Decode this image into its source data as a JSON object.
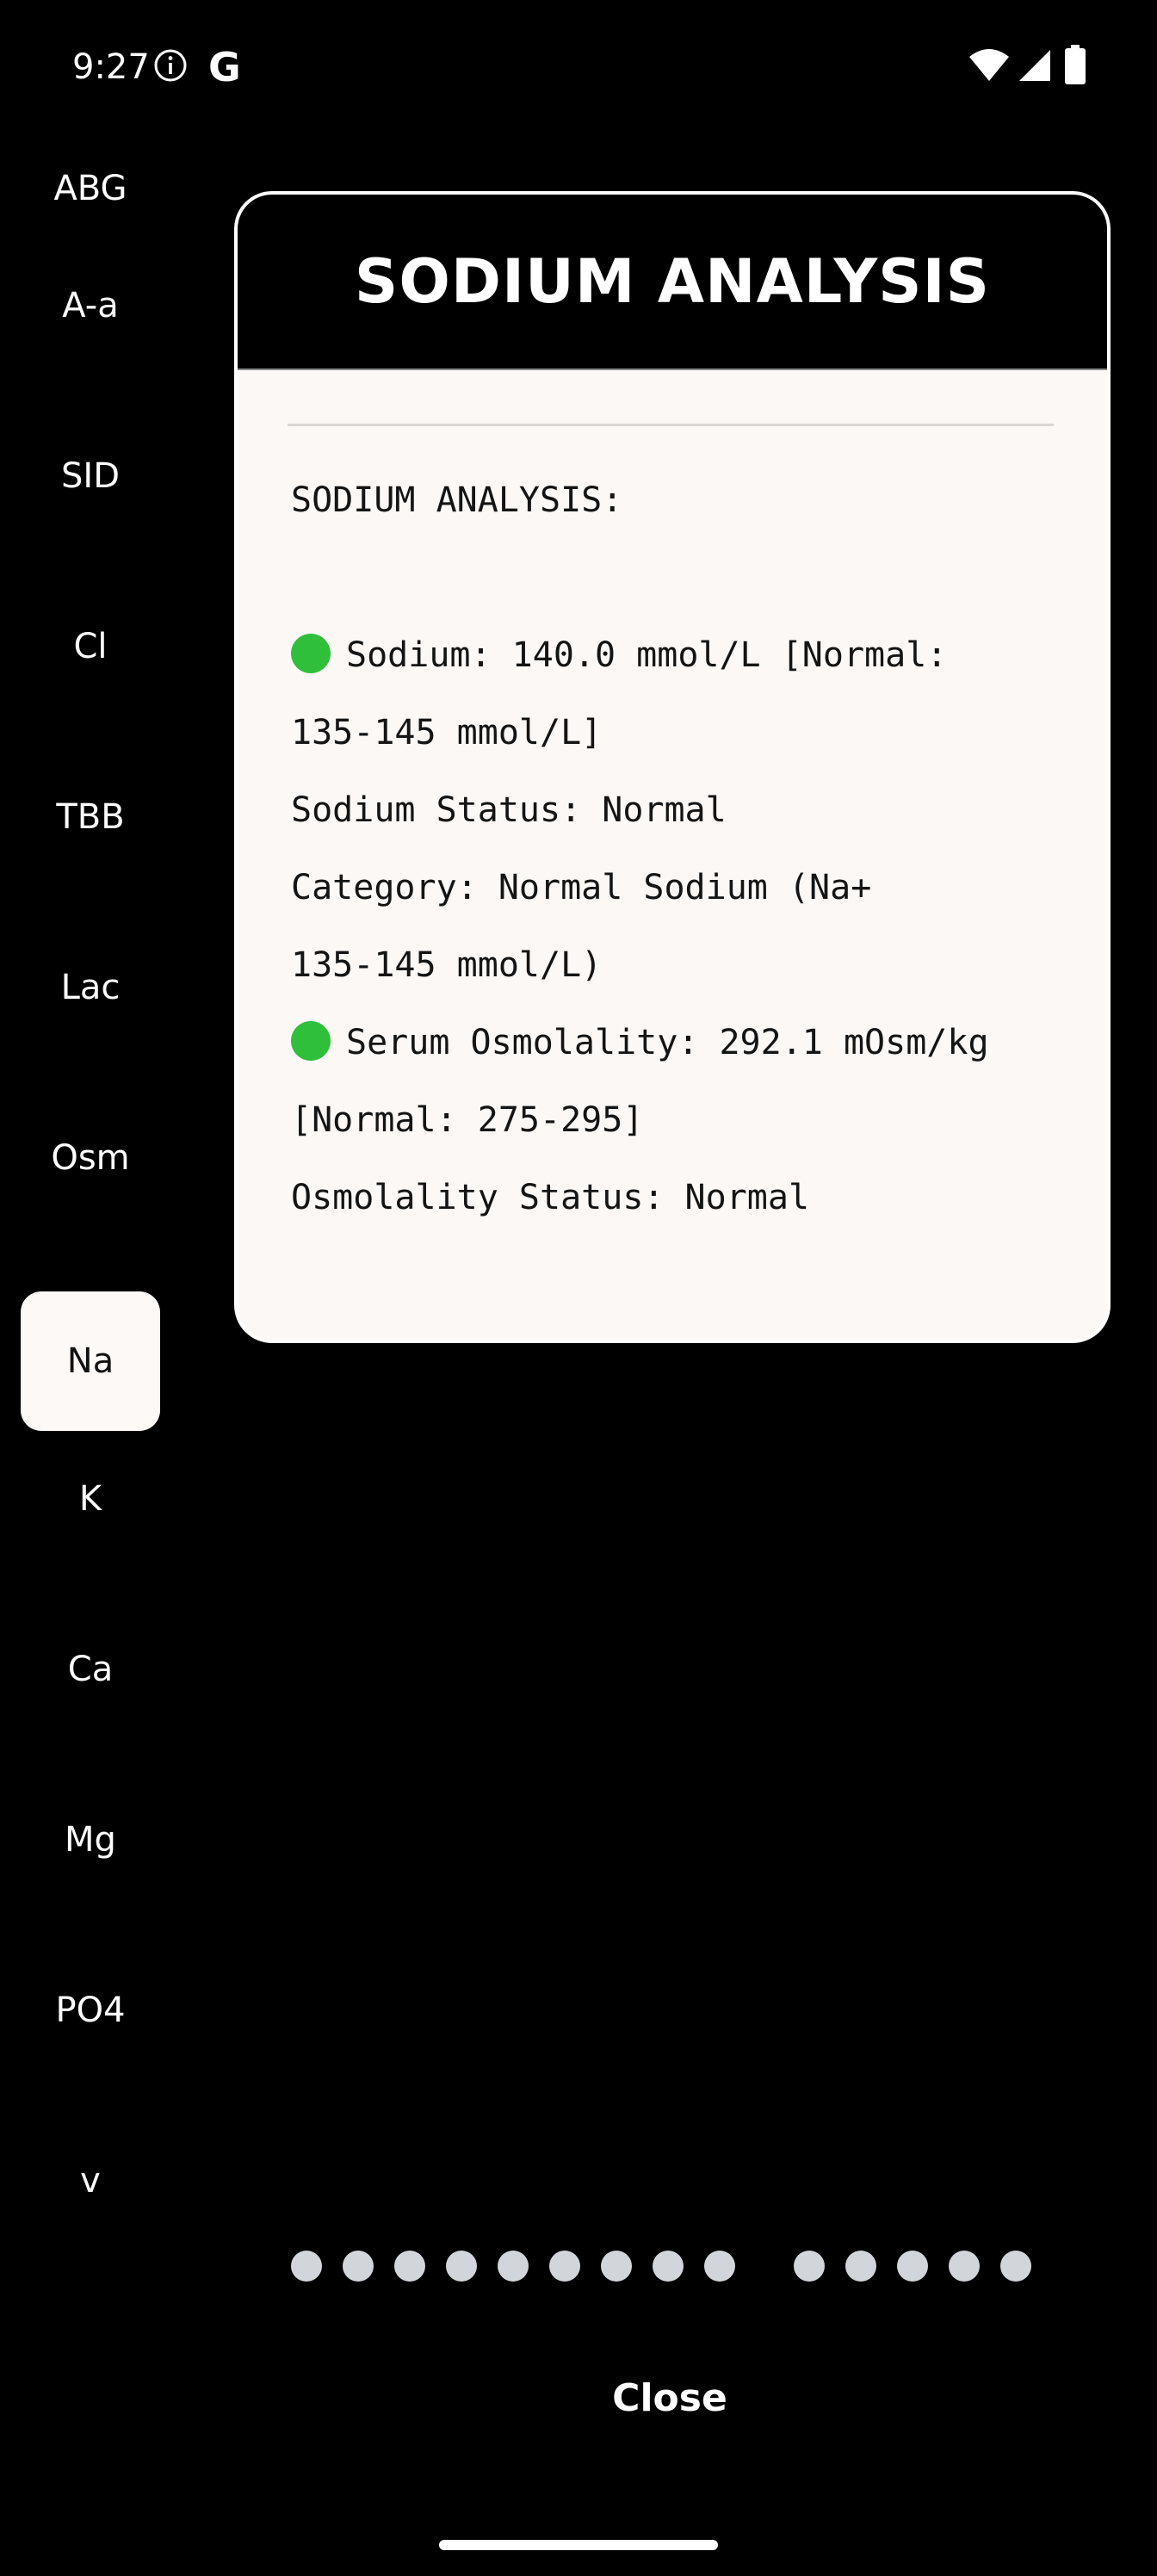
{
  "status_bar": {
    "time": "9:27",
    "icons": [
      "info-icon",
      "google-icon",
      "wifi-icon",
      "signal-icon",
      "battery-icon"
    ],
    "google_letter": "G"
  },
  "rail": {
    "items": [
      {
        "label": "ABG",
        "active": false
      },
      {
        "label": "A-a",
        "active": false
      },
      {
        "label": "SID",
        "active": false
      },
      {
        "label": "Cl",
        "active": false
      },
      {
        "label": "TBB",
        "active": false
      },
      {
        "label": "Lac",
        "active": false
      },
      {
        "label": "Osm",
        "active": false
      },
      {
        "label": "Na",
        "active": true
      },
      {
        "label": "K",
        "active": false
      },
      {
        "label": "Ca",
        "active": false
      },
      {
        "label": "Mg",
        "active": false
      },
      {
        "label": "PO4",
        "active": false
      },
      {
        "label": "v",
        "active": false
      }
    ]
  },
  "dialog": {
    "title": "SODIUM ANALYSIS",
    "heading": "SODIUM ANALYSIS:",
    "lines": {
      "sodium_a": "Sodium: 140.0 mmol/L [Normal:",
      "sodium_b": "135-145 mmol/L]",
      "sodium_status": "Sodium Status: Normal",
      "category_a": "Category: Normal Sodium (Na+",
      "category_b": "135-145 mmol/L)",
      "osm_a": "Serum Osmolality: 292.1 mOsm/kg",
      "osm_b": "[Normal: 275-295]",
      "osm_status": "Osmolality Status: Normal"
    },
    "colors": {
      "status_normal": "#2fbf3a"
    }
  },
  "pager": {
    "dot_count": 14
  },
  "close_label": "Close"
}
